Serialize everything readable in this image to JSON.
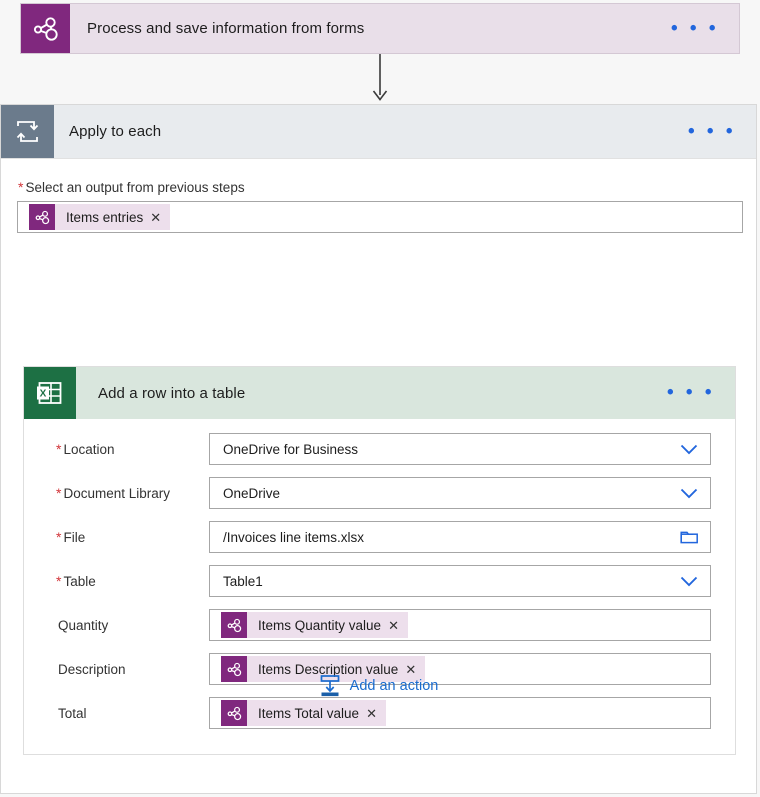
{
  "trigger": {
    "title": "Process and save information from forms",
    "icon": "forms-molecule-icon",
    "menu_label": "• • •",
    "bg_color": "#e9dfe9",
    "icon_color": "#80287e"
  },
  "loop": {
    "title": "Apply to each",
    "icon": "loop-repeat-icon",
    "menu_label": "• • •",
    "header_color": "#e8ebee",
    "icon_color": "#6b7b8c",
    "output_field": {
      "label": "Select an output from previous steps",
      "required_marker": "*",
      "token": {
        "label": "Items entries",
        "remove_label": "✕"
      }
    }
  },
  "excel_action": {
    "title": "Add a row into a table",
    "icon": "excel-table-icon",
    "menu_label": "• • •",
    "header_color": "#d9e6dd",
    "icon_color": "#1d7044",
    "fields": [
      {
        "label": "Location",
        "required_marker": "*",
        "value": "OneDrive for Business",
        "control": "dropdown",
        "affordance_icon": "chevron-down-icon"
      },
      {
        "label": "Document Library",
        "required_marker": "*",
        "value": "OneDrive",
        "control": "dropdown",
        "affordance_icon": "chevron-down-icon"
      },
      {
        "label": "File",
        "required_marker": "*",
        "value": "/Invoices line items.xlsx",
        "control": "filepicker",
        "affordance_icon": "folder-icon"
      },
      {
        "label": "Table",
        "required_marker": "*",
        "value": "Table1",
        "control": "dropdown",
        "affordance_icon": "chevron-down-icon"
      },
      {
        "label": "Quantity",
        "required_marker": "",
        "value": "Items Quantity value",
        "control": "token",
        "remove_label": "✕"
      },
      {
        "label": "Description",
        "required_marker": "",
        "value": "Items Description value",
        "control": "token",
        "remove_label": "✕"
      },
      {
        "label": "Total",
        "required_marker": "",
        "value": "Items Total value",
        "control": "token",
        "remove_label": "✕"
      }
    ]
  },
  "add_action": {
    "label": "Add an action",
    "icon": "insert-below-icon",
    "link_color": "#1a6bce"
  },
  "colors": {
    "accent_blue": "#2266dd",
    "required_red": "#d13438",
    "canvas": "#f7f7f7"
  }
}
